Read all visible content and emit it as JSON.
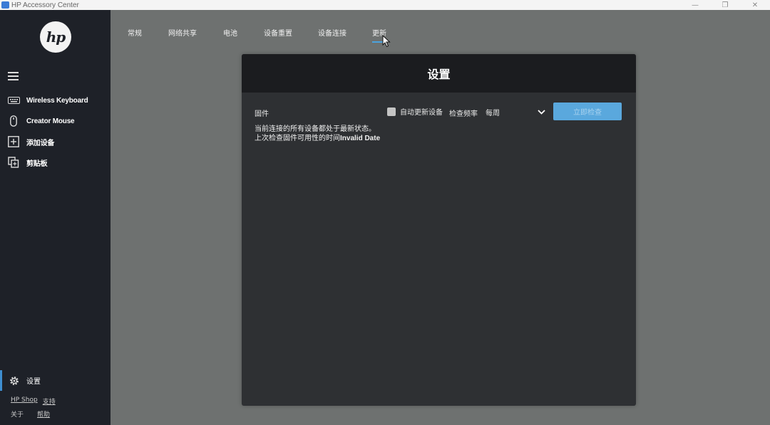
{
  "window": {
    "title": "HP Accessory Center",
    "minimize": "—",
    "restore": "❐",
    "close": "✕"
  },
  "sidebar": {
    "logo_text": "hp",
    "items": [
      {
        "label": "Wireless Keyboard",
        "icon": "keyboard-icon"
      },
      {
        "label": "Creator Mouse",
        "icon": "mouse-icon"
      },
      {
        "label": "添加设备",
        "icon": "add-device-icon"
      },
      {
        "label": "剪贴板",
        "icon": "clipboard-icon"
      }
    ],
    "settings_label": "设置",
    "footer_row1": [
      "HP Shop",
      "支持"
    ],
    "footer_row2": [
      "关于",
      "帮助"
    ]
  },
  "tabs": [
    {
      "label": "常规"
    },
    {
      "label": "网络共享"
    },
    {
      "label": "电池"
    },
    {
      "label": "设备重置"
    },
    {
      "label": "设备连接"
    },
    {
      "label": "更新",
      "active": true
    }
  ],
  "panel": {
    "title": "设置",
    "firmware_label": "固件",
    "auto_update_label": "自动更新设备",
    "auto_update_checked": false,
    "frequency_label": "检查频率",
    "frequency_value": "每周",
    "check_now_button": "立即检查",
    "status_line1": "当前连接的所有设备都处于最新状态。",
    "status_line2_prefix": "上次检查固件可用性的时间",
    "status_line2_value": "Invalid Date"
  },
  "colors": {
    "accent": "#4aa3df",
    "button": "#5aa8dd",
    "sidebar_bg": "#1e2128",
    "panel_bg": "#2e3033",
    "panel_header_bg": "#1b1c1f"
  }
}
